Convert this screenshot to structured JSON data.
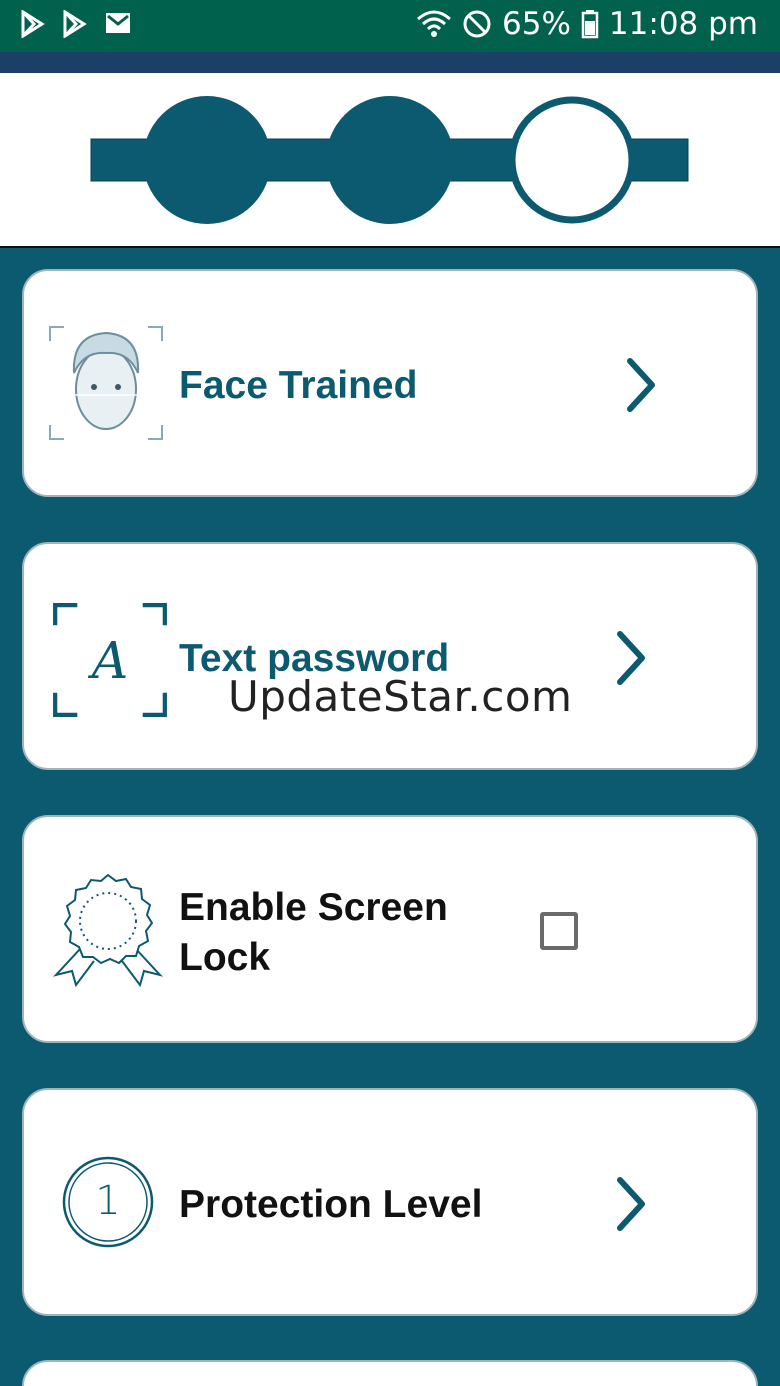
{
  "status_bar": {
    "battery": "65%",
    "time": "11:08 pm",
    "icons": [
      "play-store-icon",
      "play-store-icon",
      "gmail-icon",
      "wifi-icon",
      "do-not-disturb-icon",
      "battery-icon"
    ]
  },
  "stepper": {
    "total_steps": 3,
    "completed_steps": 2,
    "color": "#0c5a70"
  },
  "cards": [
    {
      "label": "Face Trained",
      "icon": "face-scan-icon",
      "action": "chevron-right-icon"
    },
    {
      "label": "Text password",
      "icon": "text-scan-icon",
      "action": "chevron-right-icon"
    },
    {
      "label": "Enable Screen Lock",
      "icon": "badge-icon",
      "action": "checkbox",
      "checked": false
    },
    {
      "label": "Protection Level",
      "icon": "level-one-icon",
      "level_digit": "1",
      "action": "chevron-right-icon"
    }
  ],
  "watermark": "UpdateStar.com",
  "colors": {
    "accent": "#0c5a70",
    "status_bar": "#00614d",
    "app_bar": "#1b3f66"
  }
}
